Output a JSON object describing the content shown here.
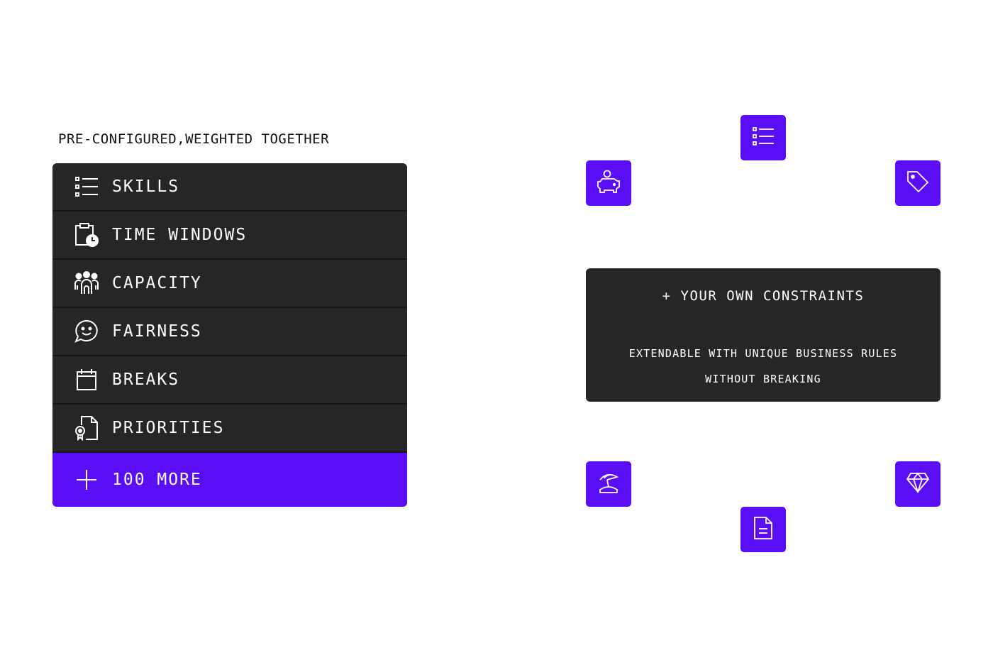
{
  "heading": "PRE-CONFIGURED,WEIGHTED TOGETHER",
  "constraints": [
    {
      "label": "SKILLS",
      "icon": "list-icon"
    },
    {
      "label": "TIME WINDOWS",
      "icon": "clipboard-clock-icon"
    },
    {
      "label": "CAPACITY",
      "icon": "people-group-icon"
    },
    {
      "label": "FAIRNESS",
      "icon": "smile-chat-icon"
    },
    {
      "label": "BREAKS",
      "icon": "calendar-icon"
    },
    {
      "label": "PRIORITIES",
      "icon": "document-badge-icon"
    }
  ],
  "more": {
    "label": "100 MORE",
    "icon": "plus-icon"
  },
  "card": {
    "title": "+ YOUR OWN CONSTRAINTS",
    "desc_line1": "EXTENDABLE WITH UNIQUE BUSINESS RULES",
    "desc_line2": "WITHOUT BREAKING"
  },
  "tiles": [
    "list-icon",
    "piggy-bank-icon",
    "tag-icon",
    "beach-umbrella-icon",
    "diamond-icon",
    "document-icon"
  ],
  "colors": {
    "accent": "#5a0ef5",
    "panel": "#262626",
    "divider": "#161616",
    "text_dark": "#111111",
    "text_light": "#ffffff"
  }
}
